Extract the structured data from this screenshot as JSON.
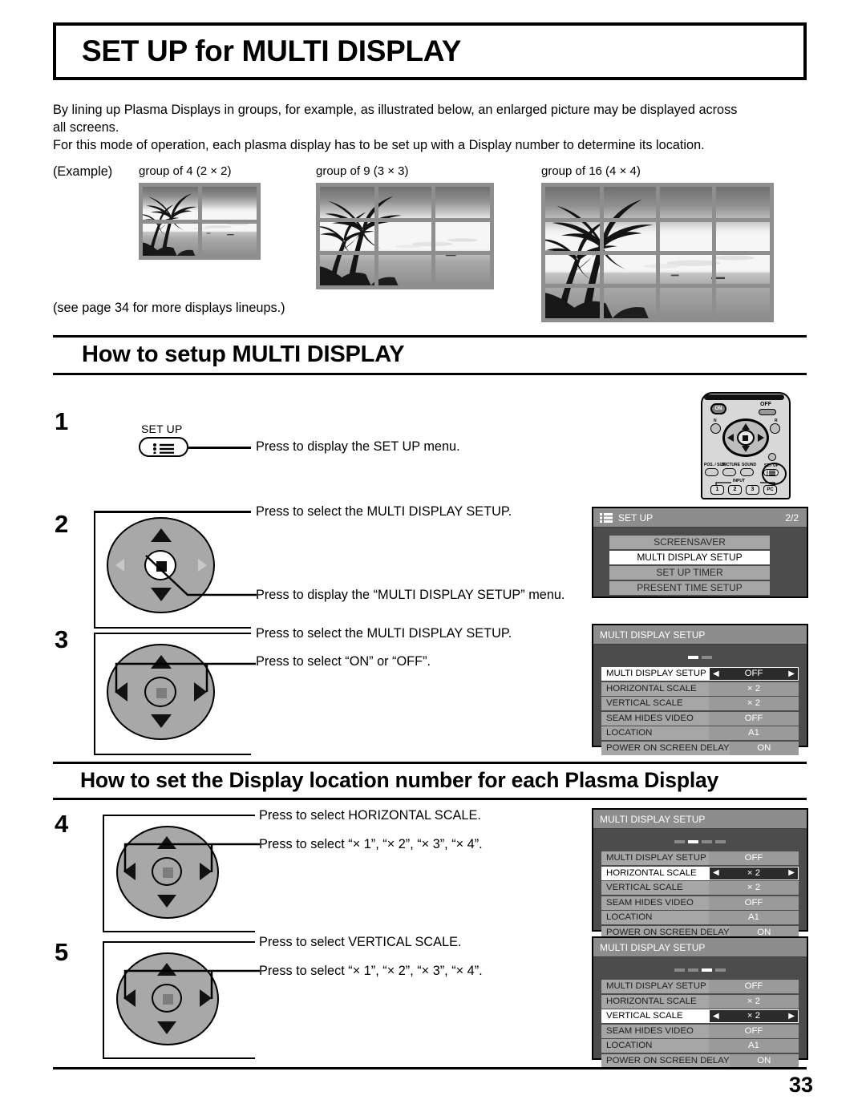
{
  "page": {
    "title": "SET UP for MULTI DISPLAY",
    "page_number": "33",
    "intro_line_1": "By lining up Plasma Displays in groups, for example, as illustrated below, an enlarged picture may be displayed across",
    "intro_line_2": "all screens.",
    "intro_line_3": "For this mode of operation, each plasma display has to be set up with a Display number to determine its location.",
    "example_label": "(Example)",
    "see_page_note": "(see page 34 for more displays lineups.)"
  },
  "examples": [
    {
      "caption": "group of 4 (2 × 2)",
      "cols": 2,
      "rows": 2
    },
    {
      "caption": "group of 9 (3 × 3)",
      "cols": 3,
      "rows": 3
    },
    {
      "caption": "group of 16 (4 × 4)",
      "cols": 4,
      "rows": 4
    }
  ],
  "sections": {
    "setup_heading": "How to setup MULTI DISPLAY",
    "location_heading": "How to set the Display location number for each Plasma Display"
  },
  "steps": [
    {
      "number": "1",
      "key_label": "SET UP",
      "instructions": [
        "Press to display the SET UP menu."
      ]
    },
    {
      "number": "2",
      "instructions": [
        "Press to select the MULTI DISPLAY SETUP.",
        "Press to display the “MULTI DISPLAY SETUP” menu."
      ]
    },
    {
      "number": "3",
      "instructions": [
        "Press to select the MULTI DISPLAY SETUP.",
        "Press to select “ON” or “OFF”."
      ]
    },
    {
      "number": "4",
      "instructions": [
        "Press to select HORIZONTAL SCALE.",
        "Press to select “× 1”, “× 2”, “× 3”, “× 4”."
      ]
    },
    {
      "number": "5",
      "instructions": [
        "Press to select VERTICAL SCALE.",
        "Press to select “× 1”, “× 2”, “× 3”, “× 4”."
      ]
    }
  ],
  "remote": {
    "on_label": "ON",
    "off_label": "OFF",
    "n_label": "N",
    "r_label": "R",
    "pos_size_label": "POS. / SIZE",
    "picture_label": "PICTURE",
    "sound_label": "SOUND",
    "setup_label": "SET UP",
    "input_label": "INPUT",
    "inputs": [
      "1",
      "2",
      "3",
      "PC"
    ]
  },
  "osd_setup_menu": {
    "header_title": "SET UP",
    "page_indicator": "2/2",
    "items": [
      {
        "label": "SCREENSAVER",
        "selected": false
      },
      {
        "label": "MULTI DISPLAY SETUP",
        "selected": true
      },
      {
        "label": "SET UP TIMER",
        "selected": false
      },
      {
        "label": "PRESENT TIME SETUP",
        "selected": false
      }
    ]
  },
  "osd_panels": [
    {
      "header_title": "MULTI DISPLAY SETUP",
      "dashes": 2,
      "dash_active": 0,
      "active_index": 0,
      "rows": [
        {
          "label": "MULTI DISPLAY SETUP",
          "value": "OFF"
        },
        {
          "label": "HORIZONTAL SCALE",
          "value": "× 2"
        },
        {
          "label": "VERTICAL SCALE",
          "value": "× 2"
        },
        {
          "label": "SEAM HIDES VIDEO",
          "value": "OFF"
        },
        {
          "label": "LOCATION",
          "value": "A1"
        },
        {
          "label": "POWER ON SCREEN DELAY",
          "value": "ON"
        }
      ]
    },
    {
      "header_title": "MULTI DISPLAY SETUP",
      "dashes": 4,
      "dash_active": 1,
      "active_index": 1,
      "rows": [
        {
          "label": "MULTI DISPLAY SETUP",
          "value": "OFF"
        },
        {
          "label": "HORIZONTAL SCALE",
          "value": "× 2"
        },
        {
          "label": "VERTICAL SCALE",
          "value": "× 2"
        },
        {
          "label": "SEAM HIDES VIDEO",
          "value": "OFF"
        },
        {
          "label": "LOCATION",
          "value": "A1"
        },
        {
          "label": "POWER ON SCREEN DELAY",
          "value": "ON"
        }
      ]
    },
    {
      "header_title": "MULTI DISPLAY SETUP",
      "dashes": 4,
      "dash_active": 2,
      "active_index": 2,
      "rows": [
        {
          "label": "MULTI DISPLAY SETUP",
          "value": "OFF"
        },
        {
          "label": "HORIZONTAL SCALE",
          "value": "× 2"
        },
        {
          "label": "VERTICAL SCALE",
          "value": "× 2"
        },
        {
          "label": "SEAM HIDES VIDEO",
          "value": "OFF"
        },
        {
          "label": "LOCATION",
          "value": "A1"
        },
        {
          "label": "POWER ON SCREEN DELAY",
          "value": "ON"
        }
      ]
    }
  ],
  "osd_arrows": {
    "left": "◀",
    "right": "▶"
  }
}
